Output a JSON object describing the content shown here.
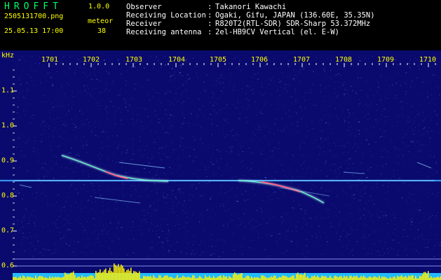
{
  "header": {
    "app_name": "HROFFT",
    "app_version": "1.0.0",
    "file_name": "2505131700.png",
    "datetime": "25.05.13 17:00",
    "count_label": "meteor",
    "count_value": "38"
  },
  "info": [
    {
      "label": "Observer",
      "value": "Takanori Kawachi"
    },
    {
      "label": "Receiving Location",
      "value": "Ogaki, Gifu, JAPAN (136.60E, 35.35N)"
    },
    {
      "label": "Receiver",
      "value": "R820T2(RTL-SDR) SDR-Sharp 53.372MHz"
    },
    {
      "label": "Receiving antenna",
      "value": "2el-HB9CV Vertical (el. E-W)"
    }
  ],
  "info_separator": ":",
  "axis": {
    "unit": "kHz",
    "time_ticks": [
      "1701",
      "1702",
      "1703",
      "1704",
      "1705",
      "1706",
      "1707",
      "1708",
      "1709",
      "1710"
    ],
    "freq_ticks": [
      "1.1",
      "1.0",
      "0.9",
      "0.8",
      "0.7",
      "0.6"
    ]
  },
  "colors": {
    "background": "#0a0a6e",
    "noise": "#2a3aa8",
    "carrier": "#7fd8ff",
    "meteor_core": "#ff5c8a",
    "meteor_glow": "#bfe8ff",
    "level_meter": "#ffee00",
    "level_base": "#22bbff",
    "tick": "#ffffff",
    "label": "#ffff00"
  }
}
